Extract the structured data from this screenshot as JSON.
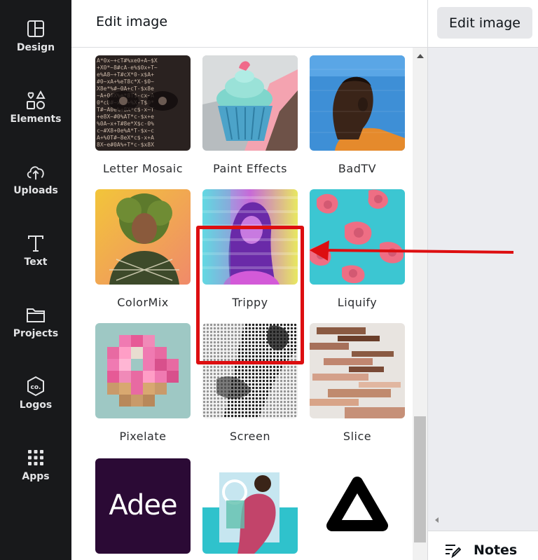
{
  "sidebar": {
    "items": [
      {
        "label": "Design",
        "icon": "design-icon"
      },
      {
        "label": "Elements",
        "icon": "elements-icon"
      },
      {
        "label": "Uploads",
        "icon": "upload-cloud-icon"
      },
      {
        "label": "Text",
        "icon": "text-icon"
      },
      {
        "label": "Projects",
        "icon": "folder-icon"
      },
      {
        "label": "Logos",
        "icon": "logo-badge-icon"
      },
      {
        "label": "Apps",
        "icon": "apps-grid-icon"
      }
    ]
  },
  "panel": {
    "title": "Edit image",
    "effects": [
      {
        "label": "Letter Mosaic"
      },
      {
        "label": "Paint Effects"
      },
      {
        "label": "BadTV"
      },
      {
        "label": "ColorMix"
      },
      {
        "label": "Trippy",
        "highlighted": true
      },
      {
        "label": "Liquify"
      },
      {
        "label": "Pixelate"
      },
      {
        "label": "Screen"
      },
      {
        "label": "Slice"
      },
      {
        "label": "Adee"
      },
      {
        "label": ""
      },
      {
        "label": ""
      }
    ],
    "adee_logo_text": "Adee"
  },
  "toolbar": {
    "edit_image_label": "Edit image"
  },
  "footer": {
    "notes_label": "Notes"
  },
  "colors": {
    "sidebar_bg": "#18191b",
    "highlight": "#dd0e10",
    "arrow": "#dd0e10"
  }
}
